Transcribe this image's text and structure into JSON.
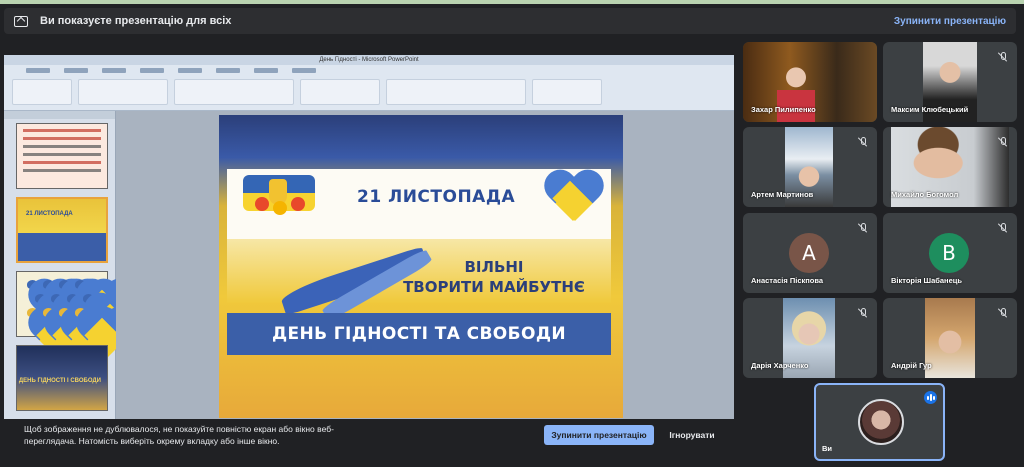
{
  "banner": {
    "title": "Ви показуєте презентацію для всіх",
    "stop_link": "Зупинити презентацію"
  },
  "presentation": {
    "window_title": "День Гідності - Microsoft PowerPoint",
    "slide": {
      "date": "21 ЛИСТОПАДА",
      "slogan_line1": "ВІЛЬНІ",
      "slogan_line2": "ТВОРИТИ МАЙБУТНЄ",
      "bar_text": "ДЕНЬ ГІДНОСТІ ТА СВОБОДИ"
    },
    "thumbnails": [
      {
        "label": "21 ЛИСТОПАДА"
      },
      {
        "label": ""
      },
      {
        "label": "ДЕНЬ ГІДНОСТІ І СВОБОДИ"
      }
    ]
  },
  "notice": {
    "message": "Щоб зображення не дублювалося, не показуйте повністю екран або вікно веб-переглядача. Натомість виберіть окрему вкладку або інше вікно.",
    "stop_button": "Зупинити презентацію",
    "ignore_button": "Ігнорувати"
  },
  "participants": [
    {
      "name": "Захар Пилипенко",
      "muted": false,
      "kind": "video"
    },
    {
      "name": "Максим Клюбецький",
      "muted": true,
      "kind": "video"
    },
    {
      "name": "Артем Мартинов",
      "muted": true,
      "kind": "video"
    },
    {
      "name": "Михайло Богомол",
      "muted": true,
      "kind": "video"
    },
    {
      "name": "Анастасія Піскпова",
      "muted": true,
      "kind": "avatar",
      "initial": "А",
      "color": "#795548"
    },
    {
      "name": "Вікторія Шабанець",
      "muted": true,
      "kind": "avatar",
      "initial": "В",
      "color": "#1e8e5e"
    },
    {
      "name": "Дарія Харченко",
      "muted": true,
      "kind": "video"
    },
    {
      "name": "Андрій Гур",
      "muted": true,
      "kind": "video"
    }
  ],
  "self": {
    "name": "Ви",
    "speaking": true
  },
  "colors": {
    "accent": "#8ab4f8",
    "background": "#202124",
    "tile": "#3c4043"
  }
}
